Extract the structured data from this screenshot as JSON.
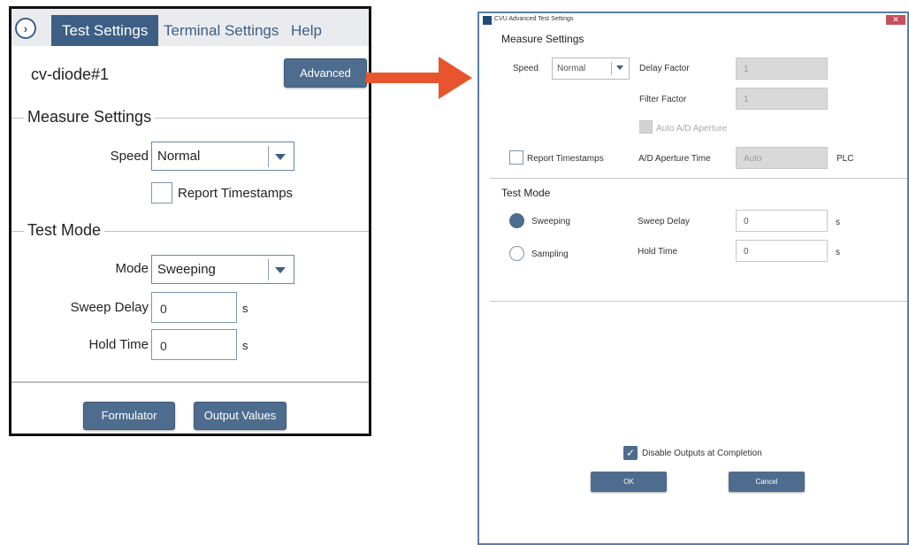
{
  "left_panel": {
    "tabs": [
      {
        "label": "Test Settings",
        "active": true
      },
      {
        "label": "Terminal Settings",
        "active": false
      },
      {
        "label": "Help",
        "active": false
      }
    ],
    "device_name": "cv-diode#1",
    "advanced_button": "Advanced",
    "measure_settings": {
      "title": "Measure Settings",
      "speed_label": "Speed",
      "speed_value": "Normal",
      "report_timestamps_label": "Report Timestamps",
      "report_timestamps_checked": false
    },
    "test_mode": {
      "title": "Test Mode",
      "mode_label": "Mode",
      "mode_value": "Sweeping",
      "sweep_delay_label": "Sweep Delay",
      "sweep_delay_value": "0",
      "sweep_delay_unit": "s",
      "hold_time_label": "Hold Time",
      "hold_time_value": "0",
      "hold_time_unit": "s"
    },
    "buttons": {
      "formulator": "Formulator",
      "output_values": "Output Values"
    }
  },
  "arrow_color": "#e8542d",
  "dialog": {
    "title": "CVU Advanced Test Settings",
    "close_symbol": "✕",
    "measure_settings": {
      "title": "Measure Settings",
      "speed_label": "Speed",
      "speed_value": "Normal",
      "delay_factor_label": "Delay Factor",
      "delay_factor_value": "1",
      "filter_factor_label": "Filter Factor",
      "filter_factor_value": "1",
      "auto_ad_aperture_label": "Auto A/D Aperture",
      "report_timestamps_label": "Report Timestamps",
      "ad_aperture_time_label": "A/D Aperture Time",
      "ad_aperture_time_value": "Auto",
      "ad_aperture_unit": "PLC"
    },
    "test_mode": {
      "title": "Test Mode",
      "sweeping_label": "Sweeping",
      "sampling_label": "Sampling",
      "selected": "Sweeping",
      "sweep_delay_label": "Sweep Delay",
      "sweep_delay_value": "0",
      "sweep_delay_unit": "s",
      "hold_time_label": "Hold Time",
      "hold_time_value": "0",
      "hold_time_unit": "s"
    },
    "disable_outputs_label": "Disable Outputs at Completion",
    "disable_outputs_checked": true,
    "ok_button": "OK",
    "cancel_button": "Cancel"
  },
  "colors": {
    "accent": "#3d5f86",
    "button": "#4e6d8e",
    "arrow": "#e8542d"
  }
}
